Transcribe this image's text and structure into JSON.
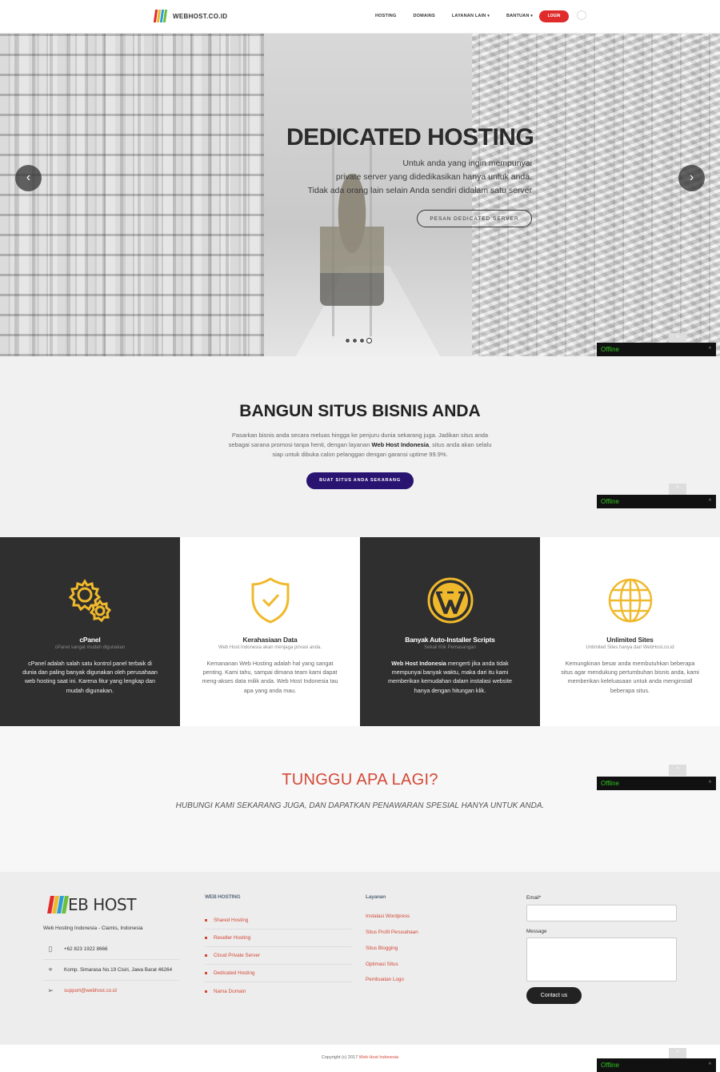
{
  "nav": {
    "logo_text": "WEBHOST.CO.ID",
    "links": [
      "HOSTING",
      "DOMAINS",
      "LAYANAN LAIN",
      "BANTUAN"
    ],
    "login_label": "LOGIN",
    "dropdown_caret": "▾"
  },
  "hero": {
    "title": "DEDICATED HOSTING",
    "subtitle_lines": [
      "Untuk anda yang ingin mempunyai",
      "private server yang didedikasikan hanya untuk anda.",
      "Tidak ada orang lain selain Anda sendiri didalam satu server"
    ],
    "cta_label": "PESAN DEDICATED SERVER",
    "prev_arrow": "‹",
    "next_arrow": "›",
    "slide_count": 4,
    "active_slide": 4
  },
  "chat_widget": {
    "status": "Offline",
    "caret": "^"
  },
  "build": {
    "title": "BANGUN SITUS BISNIS ANDA",
    "text_before": "Pasarkan bisnis anda secara meluas hingga ke penjuru dunia sekarang juga. Jadikan situs anda sebagai sarana promosi tanpa henti, dengan layanan ",
    "text_bold": "Web Host Indonesia",
    "text_after": ", situs anda akan selalu siap untuk dibuka calon pelanggan dengan garansi uptime 99.9%.",
    "button_label": "BUAT SITUS ANDA SEKARANG"
  },
  "features": [
    {
      "icon": "gears-icon",
      "title": "cPanel",
      "subtitle": "cPanel sangat mudah digunakan",
      "text_bold": "",
      "text": "cPanel adalah salah satu kontrol panel terbaik di dunia dan paling banyak digunakan oleh perusahaan web hosting saat ini. Karena fitur yang lengkap dan mudah digunakan."
    },
    {
      "icon": "shield-check-icon",
      "title": "Kerahasiaan Data",
      "subtitle": "Web Host Indonesia akan menjaga privasi anda.",
      "text_bold": "",
      "text": "Kemananan Web Hosting adalah hal yang sangat penting. Kami tahu, sampai dimana team kami dapat meng-akses data milik anda. Web Host Indonesia tau apa yang anda mau."
    },
    {
      "icon": "wordpress-icon",
      "title": "Banyak Auto-Installer Scripts",
      "subtitle": "Sekali Klik Pemasangan",
      "text_bold": "Web Host Indonesia",
      "text": " mengerti jika anda tidak mempunyai banyak waktu, maka dari itu kami memberikan kemudahan dalam instalasi website hanya dengan hitungan klik."
    },
    {
      "icon": "globe-icon",
      "title": "Unlimited Sites",
      "subtitle": "Unlimited Sites hanya dari WebHost.co.id",
      "text_bold": "",
      "text": "Kemungkinan besar anda membutuhkan beberapa situs agar mendukung pertumbuhan bisnis anda, kami memberikan keleluasaan untuk anda menginstall beberapa situs."
    }
  ],
  "cta": {
    "title": "TUNGGU APA LAGI?",
    "subtitle": "HUBUNGI KAMI SEKARANG JUGA, DAN DAPATKAN PENAWARAN SPESIAL HANYA UNTUK ANDA."
  },
  "footer": {
    "logo_text": "EB HOST",
    "address_line": "Web Hosting Indonesia - Ciamis, Indonesia",
    "phone": "+62 823 1922 8666",
    "address": "Komp. Simarasa No.19 Cisiri, Jawa Barat 46264",
    "email": "support@webhost.co.id",
    "webhosting_heading": "WEB HOSTING",
    "webhosting_items": [
      "Shared Hosting",
      "Reseller Hosting",
      "Cloud Private Server",
      "Dedicated Hosting",
      "Nama Domain"
    ],
    "layanan_heading": "Layanan",
    "layanan_items": [
      "Instalasi Wordpress",
      "Situs Profil Perusahaan",
      "Situs Blogging",
      "Optimasi Situs",
      "Pembuatan Logo"
    ],
    "email_label": "Email*",
    "message_label": "Message",
    "submit_label": "Contact us"
  },
  "copyright": {
    "text": "Copyright (c) 2017 ",
    "link": "Web Host Indonesia"
  },
  "colors": {
    "accent_red": "#e02b2b",
    "cta_red": "#d34836",
    "button_purple": "#2a1471",
    "icon_gold": "#f0b92c",
    "dark_panel": "#2f2f2f",
    "offline_green": "#2fc41f"
  }
}
